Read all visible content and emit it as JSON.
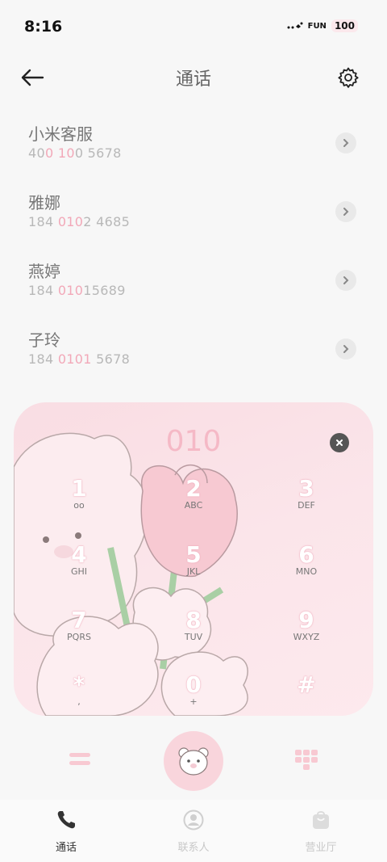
{
  "status_bar": {
    "time": "8:16",
    "signal_text": "..",
    "network_text": "FUN",
    "battery": "100"
  },
  "header": {
    "title": "通话",
    "back_icon": "arrow-left-icon",
    "settings_icon": "gear-icon"
  },
  "contacts": [
    {
      "name": "小米客服",
      "number_parts": [
        "40",
        "0",
        " ",
        "10",
        "0 5678"
      ]
    },
    {
      "name": "雅娜",
      "number_parts": [
        "184 ",
        "010",
        "2 4685"
      ]
    },
    {
      "name": "燕婷",
      "number_parts": [
        "184 ",
        "010",
        "15689"
      ]
    },
    {
      "name": "子玲",
      "number_parts": [
        "184 ",
        "0101",
        " 5678"
      ]
    }
  ],
  "dialer": {
    "entered_number": "010",
    "keys": [
      {
        "digit": "1",
        "letters": "ᴏᴏ"
      },
      {
        "digit": "2",
        "letters": "ABC"
      },
      {
        "digit": "3",
        "letters": "DEF"
      },
      {
        "digit": "4",
        "letters": "GHI"
      },
      {
        "digit": "5",
        "letters": "JKL"
      },
      {
        "digit": "6",
        "letters": "MNO"
      },
      {
        "digit": "7",
        "letters": "PQRS"
      },
      {
        "digit": "8",
        "letters": "TUV"
      },
      {
        "digit": "9",
        "letters": "WXYZ"
      },
      {
        "digit": "*",
        "letters": ","
      },
      {
        "digit": "0",
        "letters": "+"
      },
      {
        "digit": "#",
        "letters": ""
      }
    ]
  },
  "bottom_nav": {
    "items": [
      {
        "label": "通话",
        "icon": "phone-icon",
        "active": true
      },
      {
        "label": "联系人",
        "icon": "person-icon",
        "active": false
      },
      {
        "label": "营业厅",
        "icon": "shopping-bag-icon",
        "active": false
      }
    ]
  },
  "colors": {
    "accent_pink": "#f2a8b8",
    "card_bg": "#fbe5ea",
    "call_button": "#f9d5dc"
  }
}
